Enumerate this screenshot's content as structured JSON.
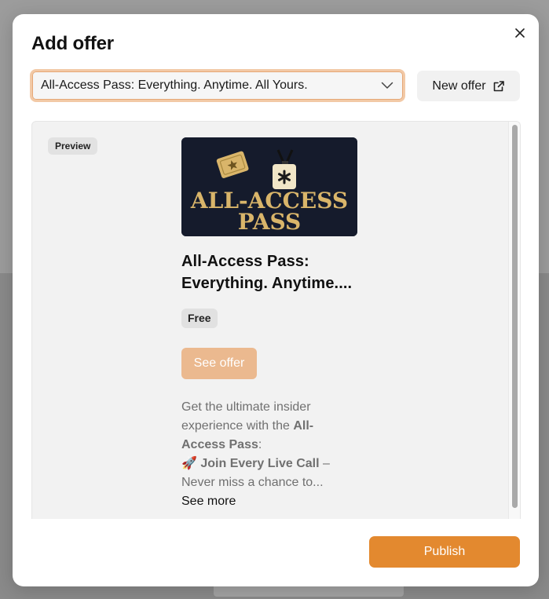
{
  "modal": {
    "title": "Add offer",
    "close_icon": "close-icon"
  },
  "offer_select": {
    "value": "All-Access Pass: Everything. Anytime. All Yours.",
    "icon": "chevron-down-icon"
  },
  "new_offer_button": {
    "label": "New offer",
    "icon": "external-link-icon"
  },
  "preview": {
    "badge": "Preview",
    "card": {
      "image_text_line1": "ALL-ACCESS",
      "image_text_line2": "PASS",
      "title_line1": "All-Access Pass:",
      "title_line2": "Everything. Anytime....",
      "price": "Free",
      "cta_label": "See offer",
      "description": {
        "line1": "Get the ultimate insider",
        "line2_prefix": "experience with the ",
        "line2_bold": "All-",
        "line3_bold": "Access Pass",
        "line3_suffix": ":",
        "line4_emoji": "🚀",
        "line4_bold": " Join Every Live Call",
        "line4_suffix": " –",
        "line5": "Never miss a chance to..."
      },
      "see_more_label": "See more"
    }
  },
  "publish_button": {
    "label": "Publish"
  },
  "colors": {
    "accent": "#e3892f",
    "accent_light": "#ebb98f",
    "select_focus": "#f2c9a6",
    "card_bg": "#151b2c",
    "gold": "#d9b56a"
  }
}
